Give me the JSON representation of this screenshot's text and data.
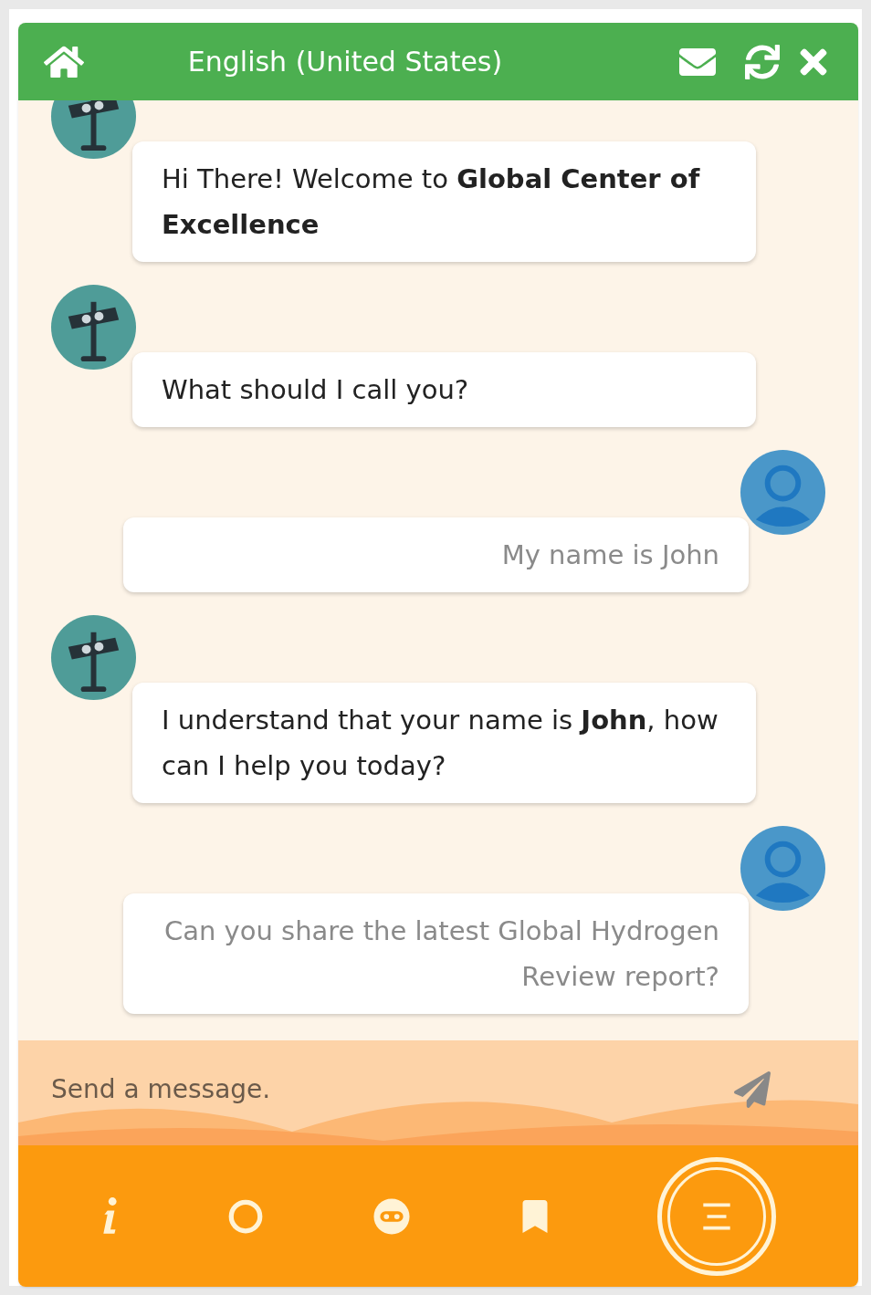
{
  "header": {
    "title": "English (United States)"
  },
  "messages": [
    {
      "kind": "bot",
      "text": "Hi There! Welcome to **Global Center of Excellence**"
    },
    {
      "kind": "bot",
      "text": "What should I call you?"
    },
    {
      "kind": "user",
      "text": "My name is John"
    },
    {
      "kind": "bot",
      "text": "I understand that your name is **John**, how can I help you today?"
    },
    {
      "kind": "user",
      "text": "Can you share the latest Global Hydrogen Review report?"
    }
  ],
  "composer": {
    "placeholder": "Send a message."
  }
}
